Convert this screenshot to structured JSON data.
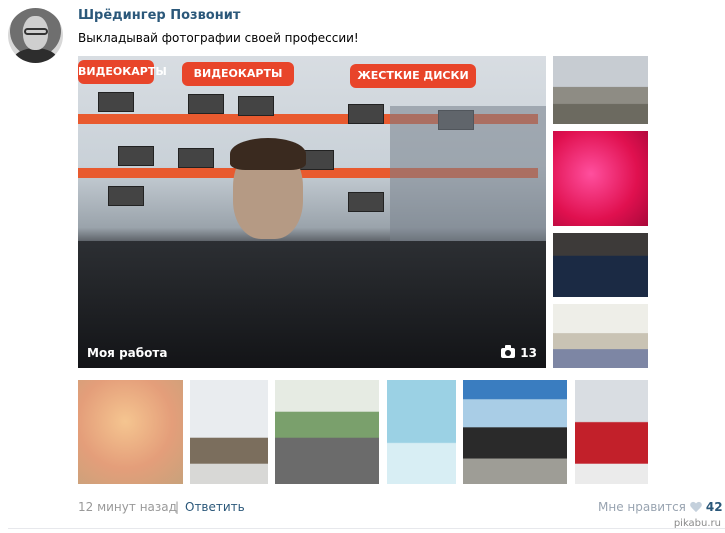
{
  "post": {
    "author": "Шрёдингер Позвонит",
    "text": "Выкладывай фотографии своей профессии!",
    "main_photo": {
      "caption": "Моя работа",
      "count": "13",
      "signs": [
        "ВИДЕОКАРТЫ",
        "ВИДЕОКАРТЫ",
        "ЖЕСТКИЕ ДИСКИ"
      ]
    },
    "footer": {
      "time": "12 минут назад",
      "separator": "|",
      "reply": "Ответить",
      "like_label": "Мне нравится",
      "like_count": "42"
    }
  },
  "icons": [
    "camera-icon",
    "heart-icon"
  ],
  "colors": {
    "link": "#2b587a",
    "muted": "#999999",
    "sign": "#e8452a"
  },
  "watermark": "pikabu.ru"
}
